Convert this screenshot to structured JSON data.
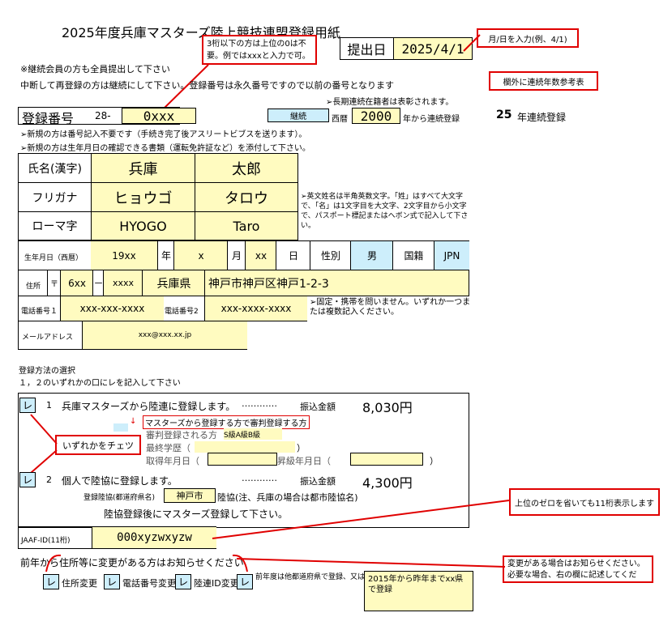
{
  "title": "2025年度兵庫マスターズ陸上競技連盟登録用紙",
  "submit": {
    "label": "提出日",
    "date": "2025/4/1"
  },
  "notes": {
    "date_hint": "月/日を入力(例、4/1)",
    "digits_hint": "3桁以下の方は上位の0は不要。例ではxxxと入力で可。",
    "renew": "※継続会員の方も全員提出して下さい",
    "resume": "中断して再登録の方は継続にして下さい。登録番号は永久番号ですので以前の番号となります",
    "consecutive_ref": "欄外に連続年数参考表",
    "long_term": "➢長期連続在籍者は表彰されます。",
    "new_number": "➢新規の方は番号記入不要です（手続き完了後アスリートビブスを送ります）。",
    "new_doc": "➢新規の方は生年月日の確認できる書類（運転免許証など）を添付して下さい。",
    "romaji": "➢英文姓名は半角英数文字。「姓」はすべて大文字で、「名」は1文字目を大文字、2文字目から小文字で、パスポート標記またはヘボン式で記入して下さい。",
    "phone": "➢固定・携帯を問いません。いずれか一つまたは複数記入ください。",
    "zero_hint": "上位のゼロを省いても11桁表示します",
    "change_hint": "変更がある場合はお知らせください。必要な場合、右の欄に記述してくだ",
    "check_either": "いずれかをチェツ"
  },
  "reg": {
    "label": "登録番号",
    "prefix": "28-",
    "number": "0xxx",
    "keizoku": "継続",
    "seireki": "西暦",
    "year": "2000",
    "suffix": "年から連続登録",
    "years": "25",
    "years_label": "年連続登録"
  },
  "name": {
    "kanji_label": "氏名(漢字)",
    "sei": "兵庫",
    "mei": "太郎",
    "kana_label": "フリガナ",
    "sei_kana": "ヒョウゴ",
    "mei_kana": "タロウ",
    "roma_label": "ローマ字",
    "sei_roma": "HYOGO",
    "mei_roma": "Taro"
  },
  "birth": {
    "label": "生年月日（西暦）",
    "year": "19xx",
    "y": "年",
    "month": "x",
    "m": "月",
    "day": "xx",
    "d": "日",
    "sex_label": "性別",
    "sex": "男",
    "nat_label": "国籍",
    "nat": "JPN"
  },
  "address": {
    "label": "住所",
    "mark": "〒",
    "zip1": "6xx",
    "dash": "－",
    "zip2": "xxxx",
    "pref": "兵庫県",
    "rest": "神戸市神戸区神戸1-2-3"
  },
  "phone": {
    "label1": "電話番号１",
    "num1": "xxx-xxx-xxxx",
    "label2": "電話番号2",
    "num2": "xxx-xxxx-xxxx"
  },
  "mail": {
    "label": "メールアドレス",
    "value": "xxx@xxx.xx.jp"
  },
  "method": {
    "title": "登録方法の選択",
    "sub": "１，２のいずれかの口にレを記入して下さい",
    "opt1": {
      "check": "レ",
      "num": "1",
      "text": "兵庫マスターズから陸連に登録します。",
      "dots": "…………",
      "fee_label": "振込金額",
      "fee": "8,030円"
    },
    "judge": {
      "head": "マスターズから登録する方で審判登録する方",
      "q1": "審判登録される方",
      "grade": "S級A級B級",
      "q2": "最終学歴（",
      "paren": "）",
      "q3": "取得年月日（",
      "q4": "昇級年月日（"
    },
    "opt2": {
      "check": "レ",
      "num": "2",
      "text": "個人で陸協に登録します。",
      "dots": "…………",
      "fee_label": "振込金額",
      "fee": "4,300円",
      "pref_label": "登録陸協(都道府県名)",
      "pref": "神戸市",
      "pref_note": "陸協(注、兵庫の場合は都市陸協名)",
      "after": "陸協登録後にマスターズ登録して下さい。"
    }
  },
  "jaaf": {
    "label": "JAAF-ID(11桁)",
    "value": "000xyzwxyzw"
  },
  "changes": {
    "intro": "前年から住所等に変更がある方はお知らせください",
    "items": [
      {
        "check": "レ",
        "label": "住所変更"
      },
      {
        "check": "レ",
        "label": "電話番号変更"
      },
      {
        "check": "レ",
        "label": "陸連ID変更"
      },
      {
        "check": "レ",
        "label": "前年度は他都道府県で登録、又は"
      }
    ],
    "memo": "2015年から昨年までxx県で登録"
  }
}
